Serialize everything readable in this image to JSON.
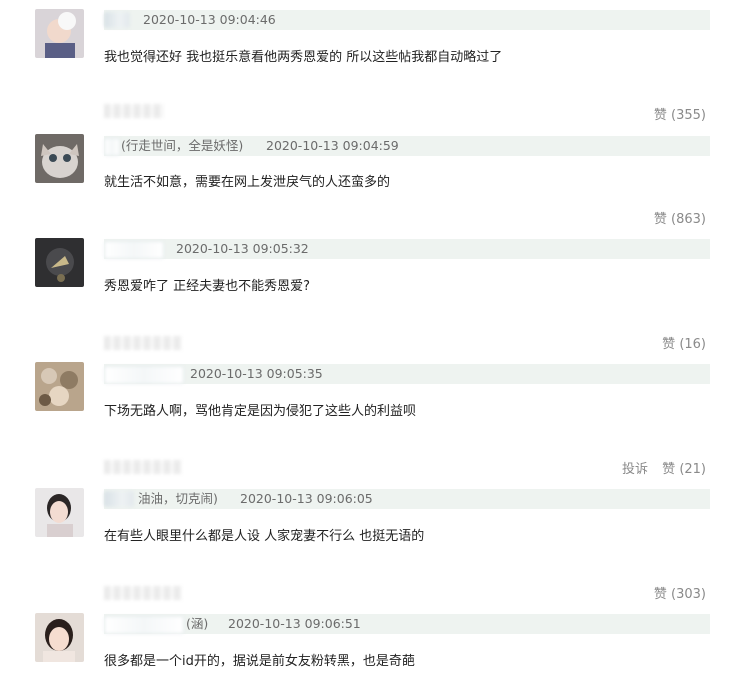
{
  "comments": [
    {
      "time": "2020-10-13 09:04:46",
      "handle": "",
      "text": "我也觉得还好 我也挺乐意看他两秀恩爱的 所以这些帖我都自动略过了",
      "like_label": "赞",
      "like_count": "(355)",
      "report_label": ""
    },
    {
      "time": "2020-10-13 09:04:59",
      "handle": "(行走世间，全是妖怪)",
      "text": "就生活不如意，需要在网上发泄戾气的人还蛮多的",
      "like_label": "赞",
      "like_count": "(863)",
      "report_label": ""
    },
    {
      "time": "2020-10-13 09:05:32",
      "handle": "",
      "text": "秀恩爱咋了 正经夫妻也不能秀恩爱?",
      "like_label": "赞",
      "like_count": "(16)",
      "report_label": ""
    },
    {
      "time": "2020-10-13 09:05:35",
      "handle": "",
      "text": "下场无路人啊，骂他肯定是因为侵犯了这些人的利益呗",
      "like_label": "赞",
      "like_count": "(21)",
      "report_label": "投诉"
    },
    {
      "time": "2020-10-13 09:06:05",
      "handle": "油油，切克闹)",
      "text": "在有些人眼里什么都是人设 人家宠妻不行么 也挺无语的",
      "like_label": "赞",
      "like_count": "(303)",
      "report_label": ""
    },
    {
      "time": "2020-10-13 09:06:51",
      "handle": "(涵)",
      "text": "很多都是一个id开的，据说是前女友粉转黑，也是奇葩",
      "like_label": "",
      "like_count": "",
      "report_label": ""
    }
  ]
}
